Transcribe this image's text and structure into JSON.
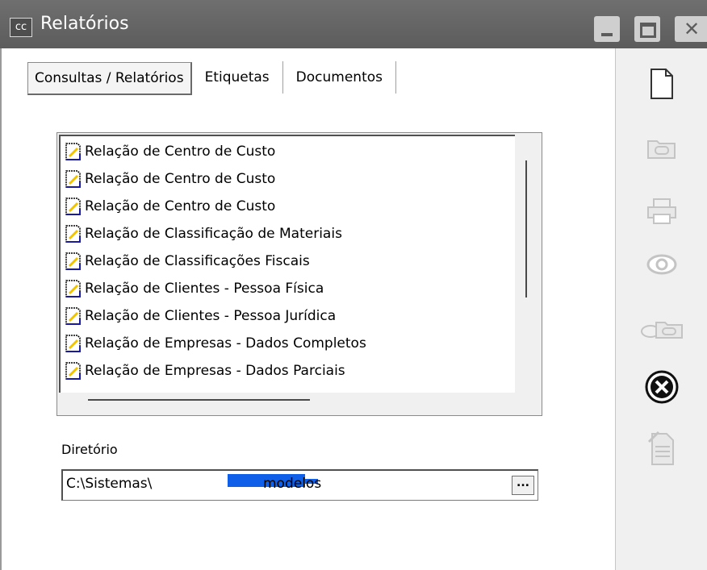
{
  "window": {
    "app_icon_text": "cc",
    "title": "Relatórios"
  },
  "tabs": [
    {
      "label": "Consultas / Relatórios",
      "active": true
    },
    {
      "label": "Etiquetas",
      "active": false
    },
    {
      "label": "Documentos",
      "active": false
    }
  ],
  "report_list": [
    "Relação de Centro de Custo",
    "Relação de Centro de Custo",
    "Relação de Centro de Custo",
    "Relação de Classificação de Materiais",
    "Relação de Classificações Fiscais",
    "Relação de Clientes - Pessoa Física",
    "Relação de Clientes - Pessoa Jurídica",
    "Relação de Empresas - Dados Completos",
    "Relação de Empresas - Dados Parciais"
  ],
  "directory": {
    "label": "Diretório",
    "value_prefix": "C:\\Sistemas\\",
    "value_suffix": "modelos",
    "browse_label": "..."
  },
  "toolbar": {
    "icons": [
      "new-document-icon",
      "open-folder-icon",
      "print-icon",
      "preview-eye-icon",
      "preview-folder-icon",
      "close-circle-icon",
      "edit-document-icon"
    ]
  },
  "colors": {
    "titlebar": "#5c5c5c",
    "panel": "#f0f0f0",
    "redaction": "#0f5fe8"
  }
}
